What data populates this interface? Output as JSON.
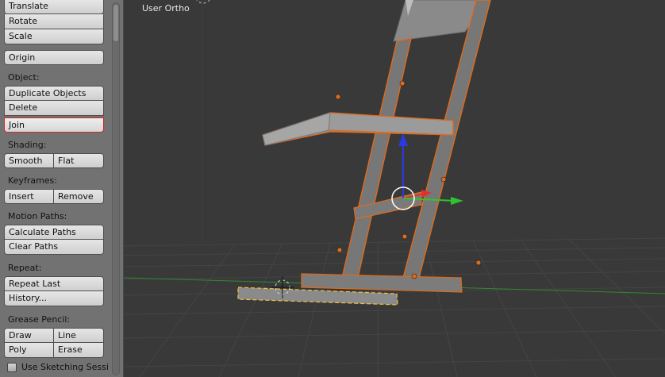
{
  "toolshelf": {
    "transform": {
      "translate": "Translate",
      "rotate": "Rotate",
      "scale": "Scale"
    },
    "origin": "Origin",
    "object": {
      "heading": "Object:",
      "duplicate": "Duplicate Objects",
      "delete": "Delete",
      "join": "Join"
    },
    "shading": {
      "heading": "Shading:",
      "smooth": "Smooth",
      "flat": "Flat"
    },
    "keyframes": {
      "heading": "Keyframes:",
      "insert": "Insert",
      "remove": "Remove"
    },
    "motion_paths": {
      "heading": "Motion Paths:",
      "calculate": "Calculate Paths",
      "clear": "Clear Paths"
    },
    "repeat": {
      "heading": "Repeat:",
      "last": "Repeat Last",
      "history": "History..."
    },
    "grease_pencil": {
      "heading": "Grease Pencil:",
      "draw": "Draw",
      "line": "Line",
      "poly": "Poly",
      "erase": "Erase",
      "sketching_label": "Use Sketching Sessio"
    }
  },
  "viewport": {
    "view_name": "User Ortho"
  },
  "colors": {
    "background": "#393939",
    "selection_outline": "#e06a1a",
    "axis_x": "#e23030",
    "axis_y": "#2ec42e",
    "axis_z": "#2a3ae0"
  }
}
